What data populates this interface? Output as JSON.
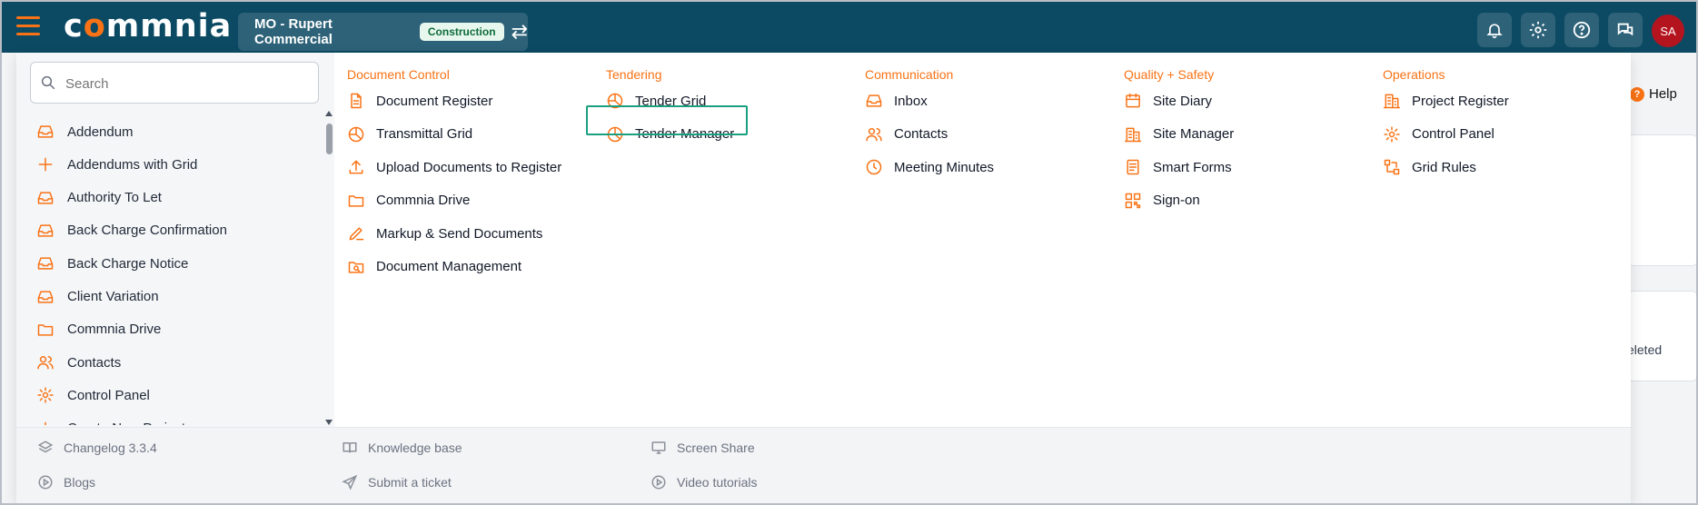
{
  "header": {
    "logo_text_1": "c",
    "logo_text_o": "o",
    "logo_text_2": "mmnia",
    "project_name": "MO - Rupert Commercial",
    "project_badge": "Construction"
  },
  "user": {
    "initials": "SA"
  },
  "background": {
    "help": "Help",
    "deleted": "eleted"
  },
  "search": {
    "placeholder": "Search"
  },
  "sidebar": {
    "items": [
      {
        "label": "Addendum",
        "icon": "inbox-icon"
      },
      {
        "label": "Addendums with Grid",
        "icon": "plus-icon"
      },
      {
        "label": "Authority To Let",
        "icon": "inbox-icon"
      },
      {
        "label": "Back Charge Confirmation",
        "icon": "inbox-icon"
      },
      {
        "label": "Back Charge Notice",
        "icon": "inbox-icon"
      },
      {
        "label": "Client Variation",
        "icon": "inbox-icon"
      },
      {
        "label": "Commnia Drive",
        "icon": "folder-icon"
      },
      {
        "label": "Contacts",
        "icon": "users-icon"
      },
      {
        "label": "Control Panel",
        "icon": "gear-icon"
      },
      {
        "label": "Create New Project",
        "icon": "plus-icon"
      }
    ]
  },
  "columns": [
    {
      "title": "Document Control",
      "items": [
        {
          "label": "Document Register",
          "icon": "document-icon"
        },
        {
          "label": "Transmittal Grid",
          "icon": "pie-chart-icon"
        },
        {
          "label": "Upload Documents to Register",
          "icon": "upload-icon"
        },
        {
          "label": "Commnia Drive",
          "icon": "folder-icon"
        },
        {
          "label": "Markup & Send Documents",
          "icon": "pen-icon"
        },
        {
          "label": "Document Management",
          "icon": "folder-search-icon"
        }
      ]
    },
    {
      "title": "Tendering",
      "items": [
        {
          "label": "Tender Grid",
          "icon": "pie-chart-icon"
        },
        {
          "label": "Tender Manager",
          "icon": "pie-chart-icon"
        }
      ]
    },
    {
      "title": "Communication",
      "items": [
        {
          "label": "Inbox",
          "icon": "inbox-icon"
        },
        {
          "label": "Contacts",
          "icon": "users-icon"
        },
        {
          "label": "Meeting Minutes",
          "icon": "clock-icon"
        }
      ]
    },
    {
      "title": "Quality + Safety",
      "items": [
        {
          "label": "Site Diary",
          "icon": "calendar-icon"
        },
        {
          "label": "Site Manager",
          "icon": "building-icon"
        },
        {
          "label": "Smart Forms",
          "icon": "form-icon"
        },
        {
          "label": "Sign-on",
          "icon": "qr-code-icon"
        }
      ]
    },
    {
      "title": "Operations",
      "items": [
        {
          "label": "Project Register",
          "icon": "building-icon"
        },
        {
          "label": "Control Panel",
          "icon": "gear-icon"
        },
        {
          "label": "Grid Rules",
          "icon": "flow-icon"
        }
      ]
    }
  ],
  "footer": {
    "changelog": "Changelog 3.3.4",
    "knowledge_base": "Knowledge base",
    "screen_share": "Screen Share",
    "blogs": "Blogs",
    "submit_ticket": "Submit a ticket",
    "video_tutorials": "Video tutorials"
  },
  "colors": {
    "header_bg": "#0c4a63",
    "accent": "#f97316",
    "highlight": "#1aa07f",
    "avatar": "#b4141e"
  }
}
